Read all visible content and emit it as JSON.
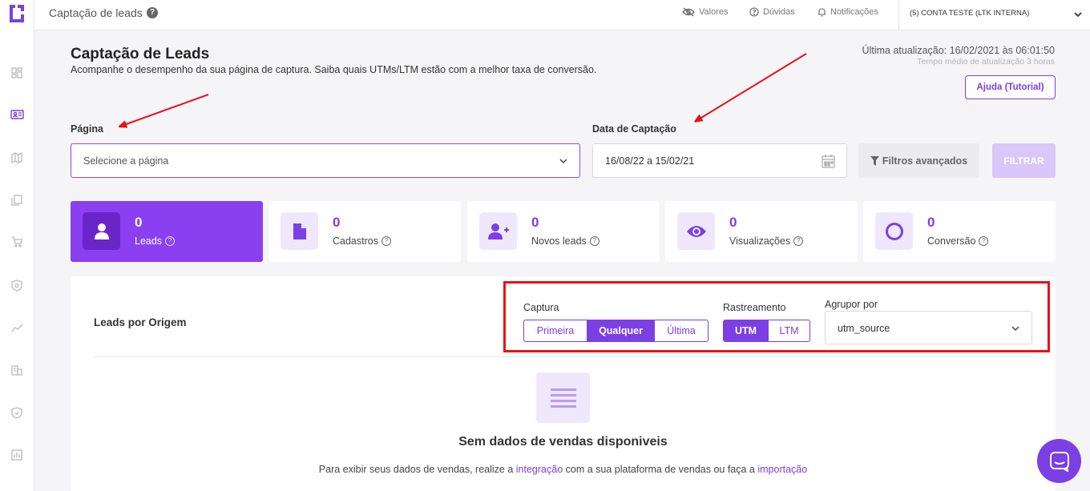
{
  "topbar": {
    "title": "Captação de leads",
    "help_label": "?",
    "links": [
      {
        "label": "Valores",
        "icon": "eye-slash-icon"
      },
      {
        "label": "Dúvidas",
        "icon": "question-circle-icon"
      },
      {
        "label": "Notificações",
        "icon": "bell-icon"
      }
    ],
    "account": "(5) CONTA TESTE (LTK INTERNA)"
  },
  "header": {
    "title": "Captação de Leads",
    "subtitle": "Acompanhe o desempenho da sua página de captura. Saiba quais UTMs/LTM estão com a melhor taxa de conversão.",
    "last_update": "Última atualização: 16/02/2021 às 06:01:50",
    "avg_update": "Tempo médio de atualização 3 horas",
    "help_button": "Ajuda (Tutorial)"
  },
  "filters": {
    "page_label": "Página",
    "page_placeholder": "Selecione a página",
    "date_label": "Data de Captação",
    "date_value": "16/08/22 a 15/02/21",
    "advanced_button": "Filtros avançados",
    "filter_button": "FILTRAR"
  },
  "cards": [
    {
      "value": "0",
      "label": "Leads",
      "icon": "user-icon",
      "active": true
    },
    {
      "value": "0",
      "label": "Cadastros",
      "icon": "document-icon",
      "active": false
    },
    {
      "value": "0",
      "label": "Novos leads",
      "icon": "user-plus-icon",
      "active": false
    },
    {
      "value": "0",
      "label": "Visualizações",
      "icon": "eye-icon",
      "active": false
    },
    {
      "value": "0",
      "label": "Conversão",
      "icon": "ring-icon",
      "active": false
    }
  ],
  "origin": {
    "title": "Leads por Origem",
    "capture_label": "Captura",
    "capture_options": [
      "Primeira",
      "Qualquer",
      "Última"
    ],
    "capture_selected": "Qualquer",
    "tracking_label": "Rastreamento",
    "tracking_options": [
      "UTM",
      "LTM"
    ],
    "tracking_selected": "UTM",
    "group_label": "Agrupor por",
    "group_value": "utm_source",
    "empty_title": "Sem dados de vendas disponiveis",
    "empty_text_pre": "Para exibir seus dados de vendas, realize a ",
    "empty_link1": "integração",
    "empty_text_mid": " com a sua plataforma de vendas ou faça a ",
    "empty_link2": "importação"
  },
  "sidebar": {
    "icons": [
      "dashboard-icon",
      "leads-icon",
      "map-icon",
      "copy-icon",
      "cart-icon",
      "shield-icon",
      "trend-icon",
      "building-icon",
      "security-icon",
      "report-icon"
    ]
  },
  "colors": {
    "accent": "#7b3fe4",
    "accent_dark": "#6a25c8",
    "annotation_red": "#e8101a"
  }
}
